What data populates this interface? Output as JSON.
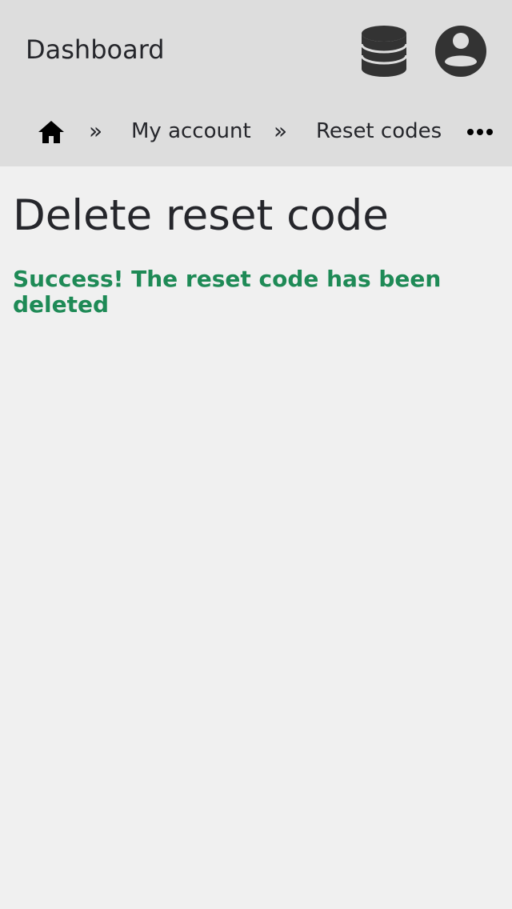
{
  "header": {
    "title": "Dashboard",
    "database_icon": "database-icon",
    "account_icon": "user-circle-icon"
  },
  "breadcrumb": {
    "home_icon": "home-icon",
    "separator": "»",
    "items": [
      {
        "label": "My account"
      },
      {
        "label": "Reset codes"
      }
    ],
    "more_icon": "more-horizontal-icon"
  },
  "main": {
    "title": "Delete reset code",
    "message": "Success! The reset code has been deleted"
  },
  "colors": {
    "header_bg": "#dddddd",
    "page_bg": "#f0f0f0",
    "text": "#25262b",
    "success": "#1e8a56",
    "icon": "#333333"
  }
}
